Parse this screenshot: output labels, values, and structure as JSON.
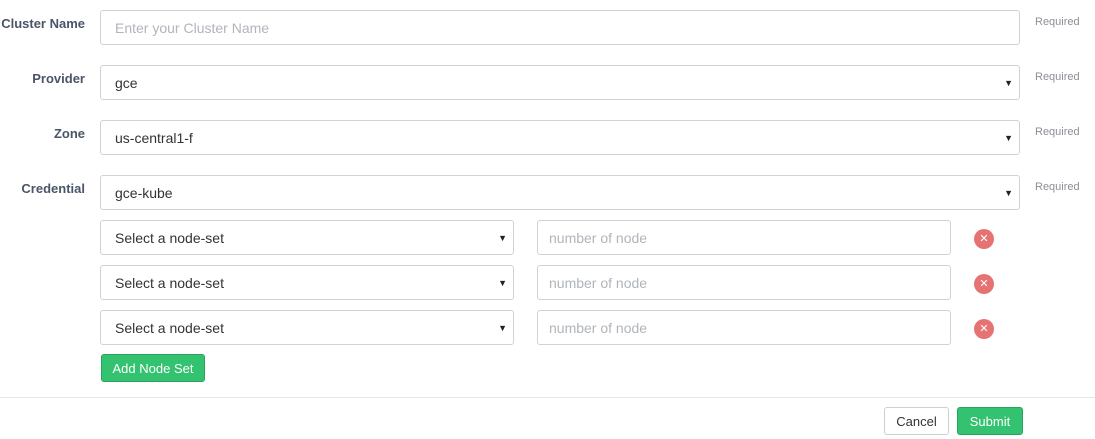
{
  "form": {
    "cluster_name": {
      "label": "Cluster Name",
      "value": "",
      "placeholder": "Enter your Cluster Name",
      "required": "Required"
    },
    "provider": {
      "label": "Provider",
      "value": "gce",
      "required": "Required"
    },
    "zone": {
      "label": "Zone",
      "value": "us-central1-f",
      "required": "Required"
    },
    "credential": {
      "label": "Credential",
      "value": "gce-kube",
      "required": "Required"
    }
  },
  "node_sets": [
    {
      "select_value": "Select a node-set",
      "count_placeholder": "number of node",
      "remove_icon": "close-icon"
    },
    {
      "select_value": "Select a node-set",
      "count_placeholder": "number of node",
      "remove_icon": "close-icon"
    },
    {
      "select_value": "Select a node-set",
      "count_placeholder": "number of node",
      "remove_icon": "close-icon"
    }
  ],
  "add_node_set_label": "Add Node Set",
  "footer": {
    "cancel_label": "Cancel",
    "submit_label": "Submit"
  },
  "colors": {
    "primary_green": "#33c26f",
    "remove_red": "#e57373"
  }
}
